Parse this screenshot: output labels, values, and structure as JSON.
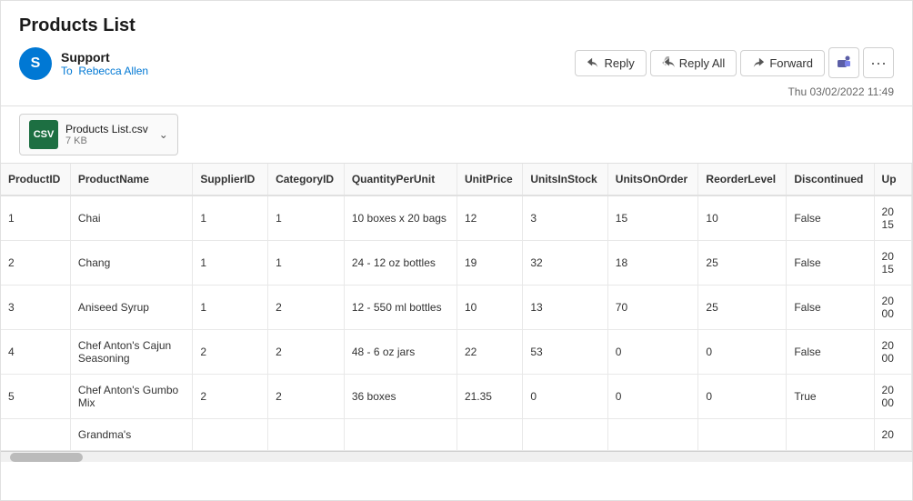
{
  "email": {
    "title": "Products List",
    "sender": {
      "initial": "S",
      "name": "Support",
      "to_label": "To",
      "recipient": "Rebecca Allen"
    },
    "timestamp": "Thu 03/02/2022 11:49",
    "buttons": {
      "reply": "Reply",
      "reply_all": "Reply All",
      "forward": "Forward"
    },
    "attachment": {
      "name": "Products List.csv",
      "size": "7 KB"
    }
  },
  "table": {
    "columns": [
      "ProductID",
      "ProductName",
      "SupplierID",
      "CategoryID",
      "QuantityPerUnit",
      "UnitPrice",
      "UnitsInStock",
      "UnitsOnOrder",
      "ReorderLevel",
      "Discontinued",
      "Up"
    ],
    "rows": [
      {
        "id": "1",
        "name": "Chai",
        "supplier": "1",
        "category": "1",
        "qpu": "10 boxes x 20 bags",
        "price": "12",
        "instock": "3",
        "onorder": "15",
        "reorder": "10",
        "discontinued": "False",
        "extra": "20\n15"
      },
      {
        "id": "2",
        "name": "Chang",
        "supplier": "1",
        "category": "1",
        "qpu": "24 - 12 oz bottles",
        "price": "19",
        "instock": "32",
        "onorder": "18",
        "reorder": "25",
        "discontinued": "False",
        "extra": "20\n15"
      },
      {
        "id": "3",
        "name": "Aniseed Syrup",
        "supplier": "1",
        "category": "2",
        "qpu": "12 - 550 ml bottles",
        "price": "10",
        "instock": "13",
        "onorder": "70",
        "reorder": "25",
        "discontinued": "False",
        "extra": "20\n00"
      },
      {
        "id": "4",
        "name": "Chef Anton's Cajun Seasoning",
        "supplier": "2",
        "category": "2",
        "qpu": "48 - 6 oz jars",
        "price": "22",
        "instock": "53",
        "onorder": "0",
        "reorder": "0",
        "discontinued": "False",
        "extra": "20\n00"
      },
      {
        "id": "5",
        "name": "Chef Anton's Gumbo Mix",
        "supplier": "2",
        "category": "2",
        "qpu": "36 boxes",
        "price": "21.35",
        "instock": "0",
        "onorder": "0",
        "reorder": "0",
        "discontinued": "True",
        "extra": "20\n00"
      },
      {
        "id": "",
        "name": "Grandma's",
        "supplier": "",
        "category": "",
        "qpu": "",
        "price": "",
        "instock": "",
        "onorder": "",
        "reorder": "",
        "discontinued": "",
        "extra": "20"
      }
    ]
  }
}
